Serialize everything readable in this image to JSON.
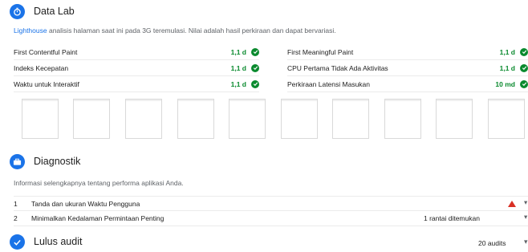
{
  "data_lab": {
    "title": "Data Lab",
    "link_text": "Lighthouse",
    "description": "analisis halaman saat ini pada 3G teremulasi. Nilai adalah hasil perkiraan dan dapat bervariasi.",
    "metrics_left": [
      {
        "label": "First Contentful Paint",
        "value": "1,1 d"
      },
      {
        "label": "Indeks Kecepatan",
        "value": "1,1 d"
      },
      {
        "label": "Waktu untuk Interaktif",
        "value": "1,1 d"
      }
    ],
    "metrics_right": [
      {
        "label": "First Meaningful Paint",
        "value": "1,1 d"
      },
      {
        "label": "CPU Pertama Tidak Ada Aktivitas",
        "value": "1,1 d"
      },
      {
        "label": "Perkiraan Latensi Masukan",
        "value": "10 md"
      }
    ]
  },
  "diagnostik": {
    "title": "Diagnostik",
    "description": "Informasi selengkapnya tentang performa aplikasi Anda.",
    "items": [
      {
        "num": "1",
        "label": "Tanda dan ukuran Waktu Pengguna",
        "detail": ""
      },
      {
        "num": "2",
        "label": "Minimalkan Kedalaman Permintaan Penting",
        "detail": "1 rantai ditemukan"
      }
    ]
  },
  "lulus_audit": {
    "title": "Lulus audit",
    "count": "20 audits"
  },
  "colors": {
    "accent": "#1a73e8",
    "pass": "#0a8a2e",
    "warn": "#d93025"
  }
}
